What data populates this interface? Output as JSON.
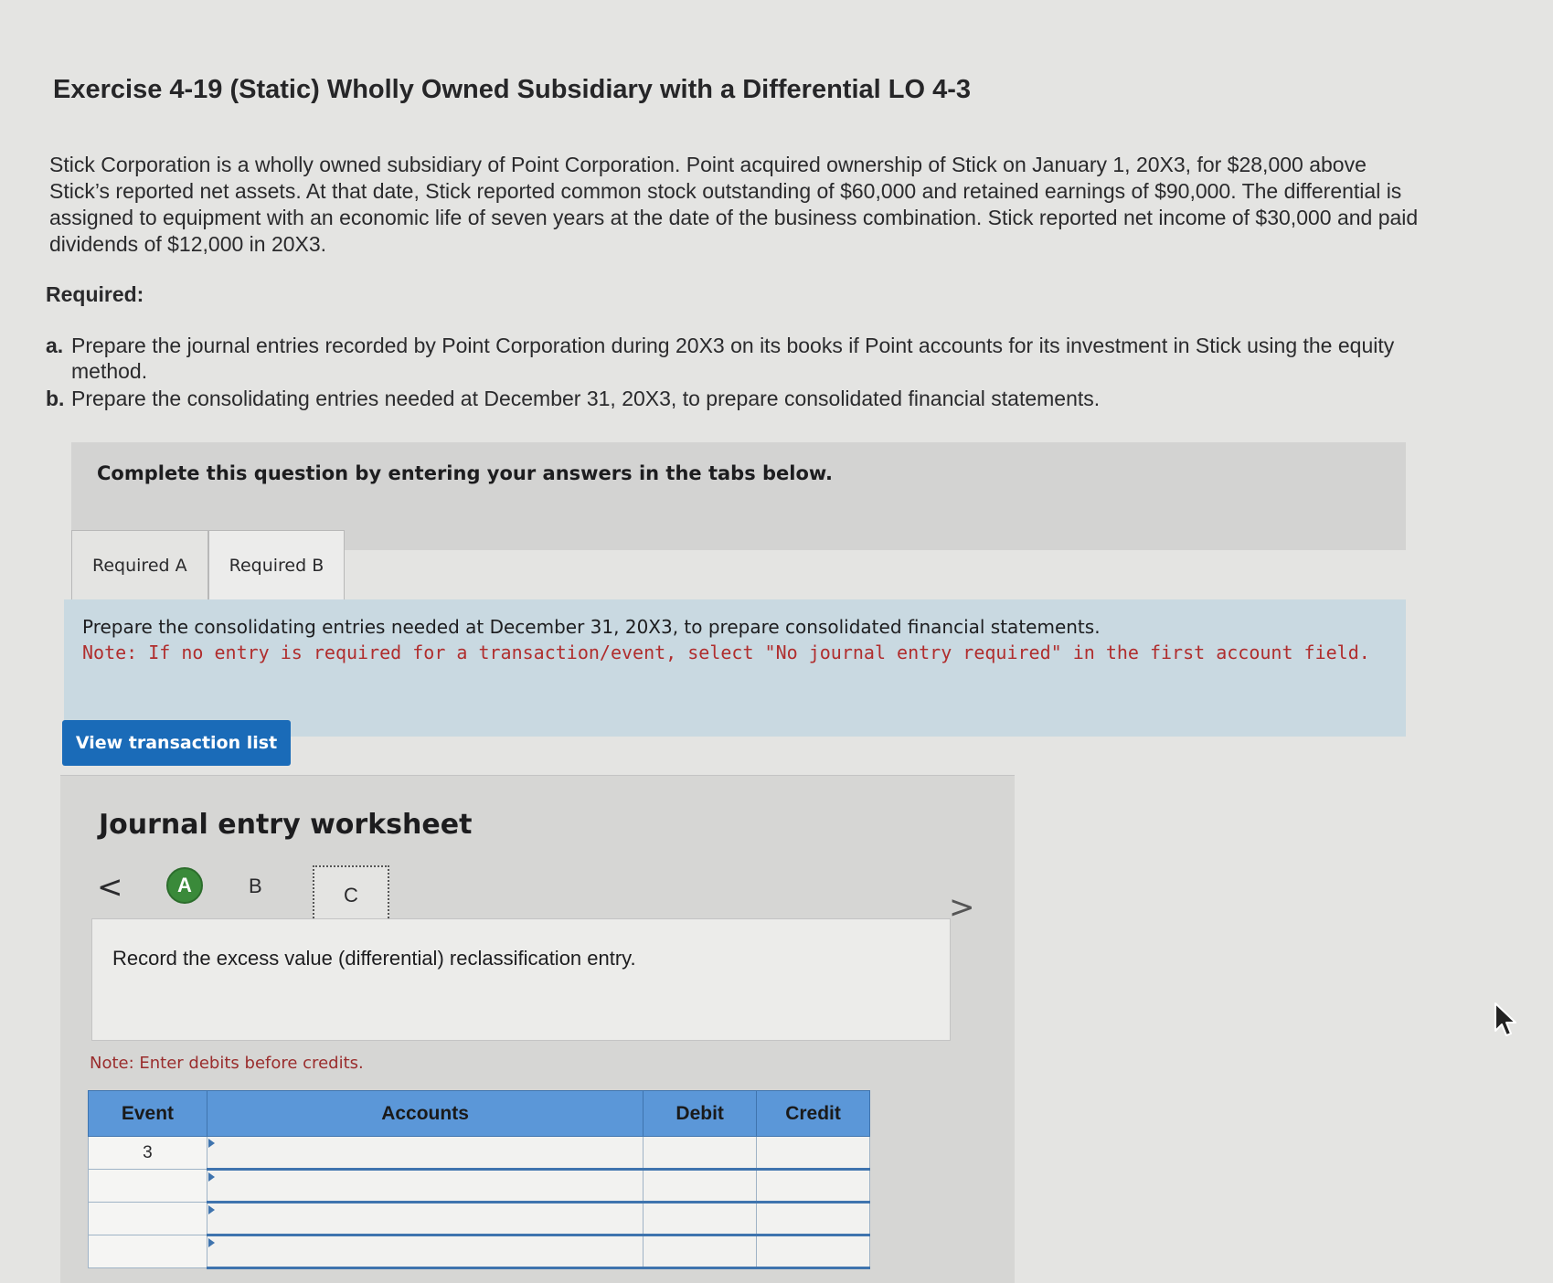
{
  "page": {
    "title": "Exercise 4-19 (Static) Wholly Owned Subsidiary with a Differential LO 4-3",
    "intro": "Stick Corporation is a wholly owned subsidiary of Point Corporation. Point acquired ownership of Stick on January 1, 20X3, for $28,000 above Stick’s reported net assets. At that date, Stick reported common stock outstanding of $60,000 and retained earnings of $90,000. The differential is assigned to equipment with an economic life of seven years at the date of the business combination. Stick reported net income of $30,000 and paid dividends of $12,000 in 20X3.",
    "required_heading": "Required:",
    "requirements": [
      {
        "letter": "a.",
        "text": "Prepare the journal entries recorded by Point Corporation during 20X3 on its books if Point accounts for its investment in Stick using the equity method."
      },
      {
        "letter": "b.",
        "text": "Prepare the consolidating entries needed at December 31, 20X3, to prepare consolidated financial statements."
      }
    ]
  },
  "instruction": "Complete this question by entering your answers in the tabs below.",
  "tabs": [
    {
      "label": "Required A",
      "active": false
    },
    {
      "label": "Required B",
      "active": true
    }
  ],
  "prompt": {
    "main": "Prepare the consolidating entries needed at December 31, 20X3, to prepare consolidated financial statements.",
    "note": "Note: If no entry is required for a transaction/event, select \"No journal entry required\" in the first account field."
  },
  "view_button": "View transaction list",
  "worksheet": {
    "title": "Journal entry worksheet",
    "steps": {
      "a": "A",
      "b": "B",
      "c": "C"
    },
    "nav_prev": "<",
    "nav_next": ">",
    "record_text": "Record the excess value (differential) reclassification entry.",
    "note": "Note: Enter debits before credits.",
    "columns": {
      "event": "Event",
      "accounts": "Accounts",
      "debit": "Debit",
      "credit": "Credit"
    },
    "rows": [
      {
        "event": "3"
      },
      {
        "event": ""
      },
      {
        "event": ""
      },
      {
        "event": ""
      }
    ]
  },
  "colors": {
    "accent_blue": "#1a6bb8",
    "table_header": "#5b97d8",
    "note_red": "#b02d2d",
    "step_green": "#3a8a3a"
  },
  "icons": [
    "chevron-left-icon",
    "chevron-right-icon",
    "mouse-cursor-icon"
  ]
}
